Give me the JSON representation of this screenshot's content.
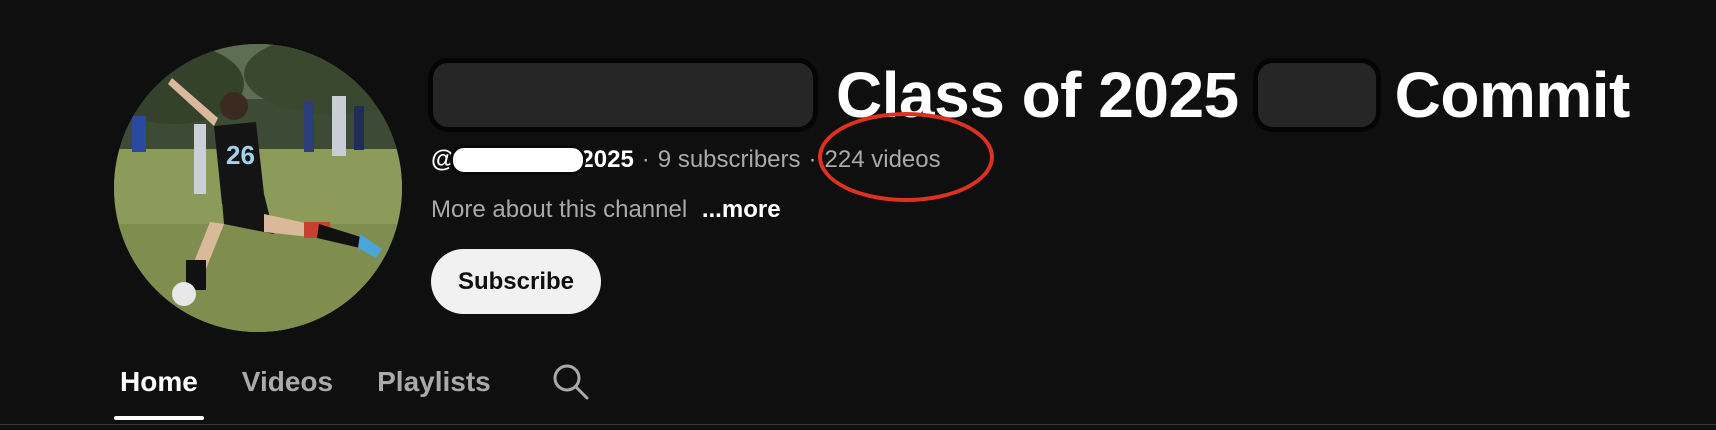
{
  "channel": {
    "title_parts": [
      "Class of 2025",
      "Commit"
    ],
    "handle_prefix": "@",
    "handle_suffix": "2025",
    "subscribers": "9 subscribers",
    "videos": "224 videos",
    "separator": "·",
    "description": "More about this channel",
    "more_label": "...more",
    "subscribe_label": "Subscribe"
  },
  "annotation": {
    "color": "#e0301e",
    "target": "224 videos"
  },
  "tabs": [
    {
      "label": "Home",
      "active": true
    },
    {
      "label": "Videos",
      "active": false
    },
    {
      "label": "Playlists",
      "active": false
    }
  ],
  "icons": {
    "search": "search-icon"
  }
}
